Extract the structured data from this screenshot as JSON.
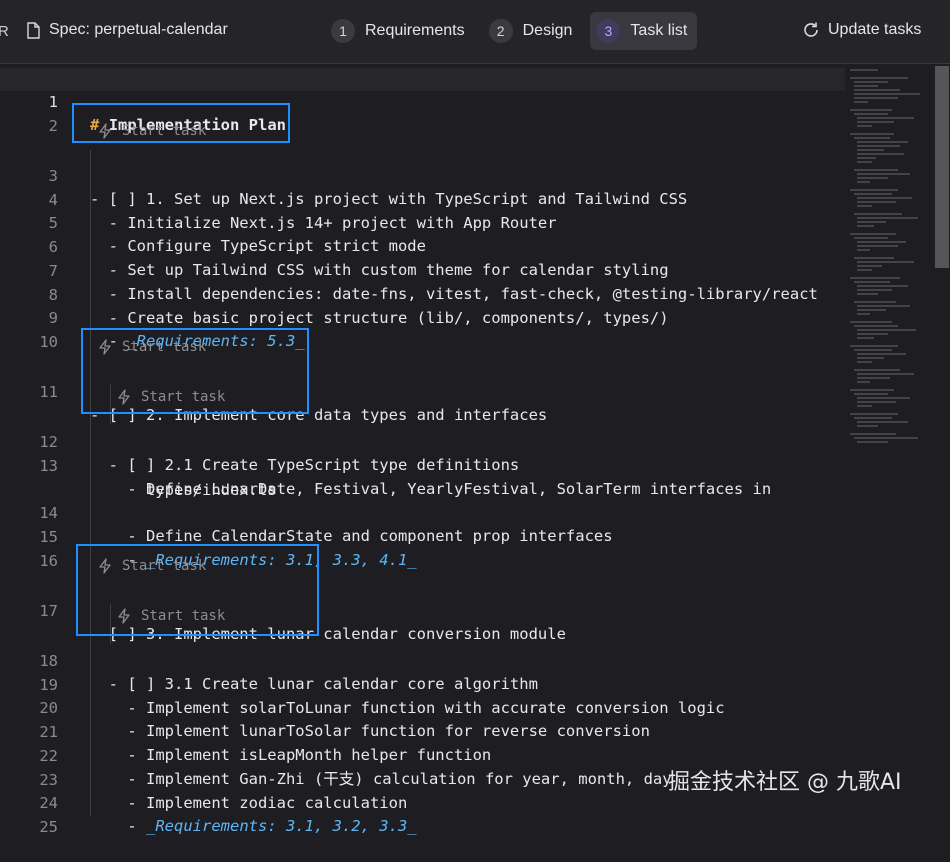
{
  "header": {
    "cut_label": "R",
    "spec_title": "Spec: perpetual-calendar",
    "steps": [
      {
        "num": "1",
        "label": "Requirements"
      },
      {
        "num": "2",
        "label": "Design"
      },
      {
        "num": "3",
        "label": "Task list"
      }
    ],
    "active_step": "Task list",
    "update_label": "Update tasks"
  },
  "codelens_label": "Start task",
  "lines": [
    {
      "n": "1",
      "text": "Implementation Plan"
    },
    {
      "n": "2",
      "text": ""
    },
    {
      "n": "3",
      "text": "- [ ] 1. Set up Next.js project with TypeScript and Tailwind CSS"
    },
    {
      "n": "4",
      "text": "  - Initialize Next.js 14+ project with App Router"
    },
    {
      "n": "5",
      "text": "  - Configure TypeScript strict mode"
    },
    {
      "n": "6",
      "text": "  - Set up Tailwind CSS with custom theme for calendar styling"
    },
    {
      "n": "7",
      "text": "  - Install dependencies: date-fns, vitest, fast-check, @testing-library/react"
    },
    {
      "n": "8",
      "text": "  - Create basic project structure (lib/, components/, types/)"
    },
    {
      "n": "9",
      "text": "_Requirements: 5.3_"
    },
    {
      "n": "10",
      "text": ""
    },
    {
      "n": "11",
      "text": "- [ ] 2. Implement core data types and interfaces"
    },
    {
      "n": "12",
      "text": "  - [ ] 2.1 Create TypeScript type definitions"
    },
    {
      "n": "13",
      "text": "    - Define LunarDate, Festival, YearlyFestival, SolarTerm interfaces in"
    },
    {
      "n": "13b",
      "text": "      types/index.ts"
    },
    {
      "n": "14",
      "text": "    - Define CalendarState and component prop interfaces"
    },
    {
      "n": "15",
      "text": "_Requirements: 3.1, 3.3, 4.1_"
    },
    {
      "n": "16",
      "text": ""
    },
    {
      "n": "17",
      "text": "- [ ] 3. Implement lunar calendar conversion module"
    },
    {
      "n": "18",
      "text": "  - [ ] 3.1 Create lunar calendar core algorithm"
    },
    {
      "n": "19",
      "text": "    - Implement solarToLunar function with accurate conversion logic"
    },
    {
      "n": "20",
      "text": "    - Implement lunarToSolar function for reverse conversion"
    },
    {
      "n": "21",
      "text": "    - Implement isLeapMonth helper function"
    },
    {
      "n": "22",
      "text": "    - Implement Gan-Zhi (干支) calculation for year, month, day"
    },
    {
      "n": "23",
      "text": "    - Implement zodiac calculation"
    },
    {
      "n": "24",
      "text": "_Requirements: 3.1, 3.2, 3.3_"
    },
    {
      "n": "25",
      "text": ""
    }
  ],
  "heading_marker": "#",
  "list_marker": "  - ",
  "watermark": "掘金技术社区 @ 九歌AI",
  "colors": {
    "background": "#1e1e22",
    "heading_marker": "#e7a64a",
    "requirements": "#5eb6f5",
    "highlight_box": "#1e90ff",
    "active_step": "#b9a8ff"
  }
}
